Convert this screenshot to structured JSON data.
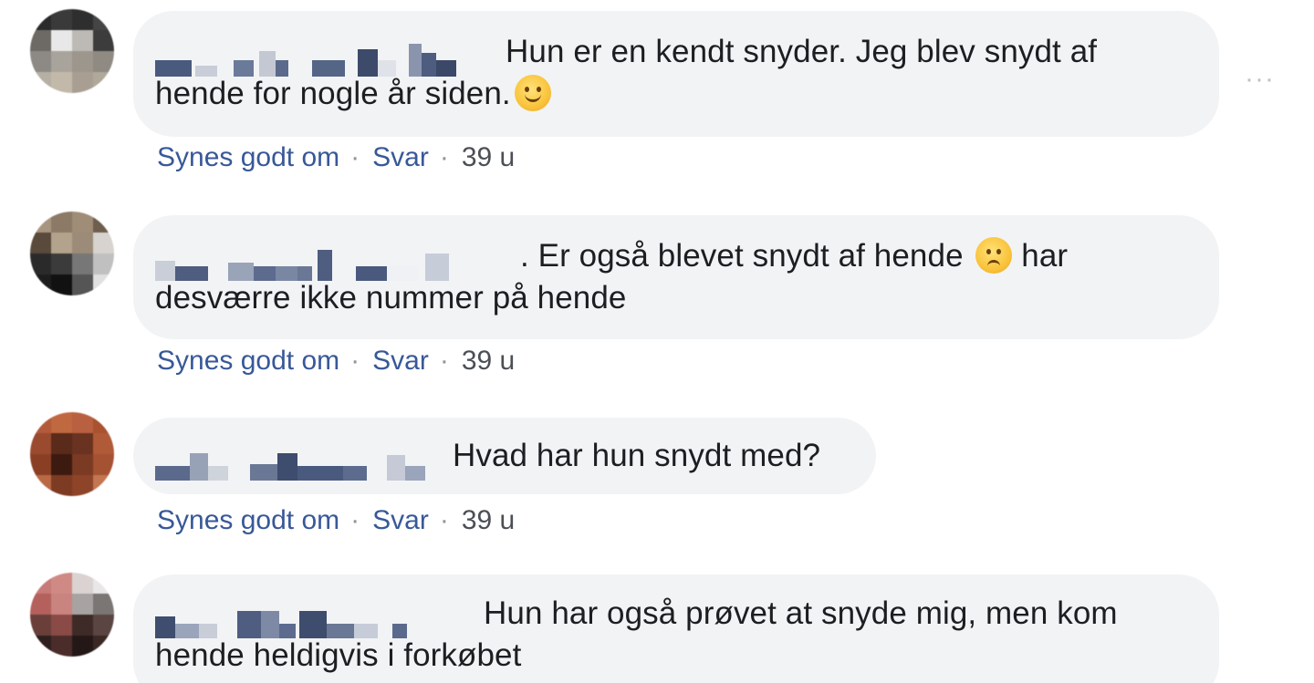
{
  "comments": [
    {
      "text": "Hun er en kendt snyder. Jeg blev snydt af hende for nogle år siden.",
      "emoji": "smiling-face-emoji",
      "like_label": "Synes godt om",
      "reply_label": "Svar",
      "time": "39 u"
    },
    {
      "text_before_emoji": ". Er også blevet snydt af hende",
      "text_after_emoji": "har desværre ikke nummer på hende",
      "emoji": "frowning-face-emoji",
      "like_label": "Synes godt om",
      "reply_label": "Svar",
      "time": "39 u"
    },
    {
      "text": "Hvad har hun snydt med?",
      "like_label": "Synes godt om",
      "reply_label": "Svar",
      "time": "39 u"
    },
    {
      "text": "Hun har også prøvet at snyde mig, men kom hende heldigvis i forkøbet"
    }
  ],
  "actions_separator": "·",
  "more_options_icon": "ellipsis-icon",
  "more_label": "···",
  "colors": {
    "bubble_bg": "#f2f3f5",
    "link": "#385898",
    "text": "#1c1e21",
    "meta": "#4b4f56"
  }
}
